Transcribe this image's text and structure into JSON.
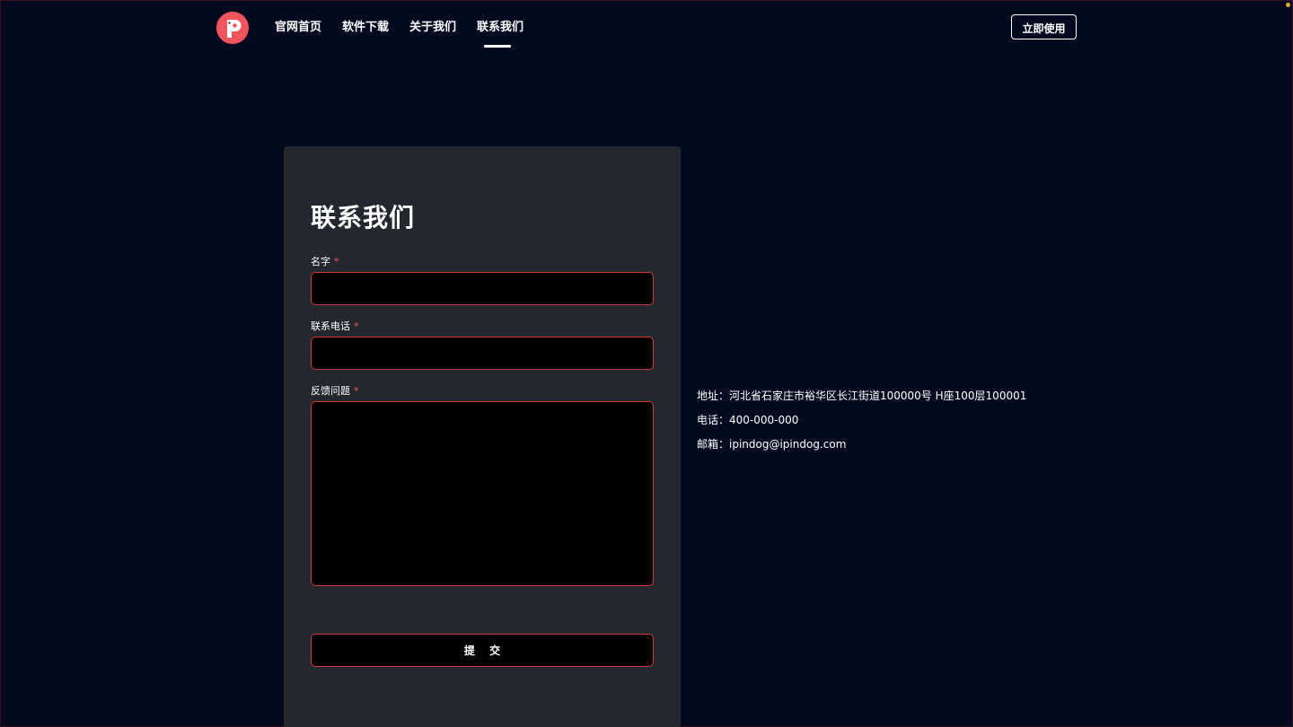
{
  "header": {
    "logo_alt": "P",
    "nav": [
      {
        "label": "官网首页"
      },
      {
        "label": "软件下载"
      },
      {
        "label": "关于我们"
      },
      {
        "label": "联系我们",
        "active": true
      }
    ],
    "cta_label": "立即使用"
  },
  "form": {
    "title": "联系我们",
    "fields": {
      "name": {
        "label": "名字",
        "required_mark": "*",
        "value": ""
      },
      "phone": {
        "label": "联系电话",
        "required_mark": "*",
        "value": ""
      },
      "feedback": {
        "label": "反馈问题",
        "required_mark": "*",
        "value": ""
      }
    },
    "submit_label": "提 交"
  },
  "contact": {
    "address": "地址：河北省石家庄市裕华区长江街道100000号 H座100层100001",
    "phone": "电话：400-000-000",
    "email": "邮箱：ipindog@ipindog.com"
  },
  "colors": {
    "background": "#030a20",
    "card": "#24272d",
    "accent": "#f0545d",
    "input_border": "#d03a3a",
    "input_bg": "#000000"
  },
  "icons": {
    "logo": "p-dog-logo-icon"
  }
}
